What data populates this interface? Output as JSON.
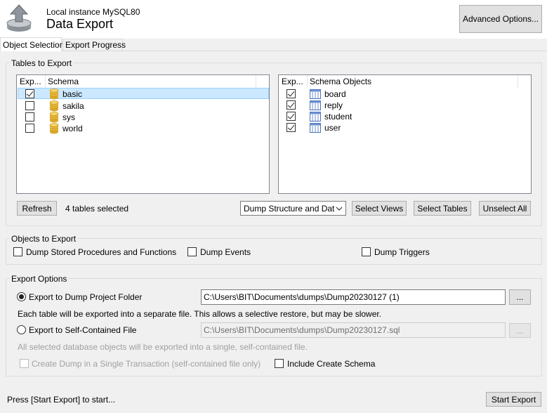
{
  "header": {
    "subtitle": "Local instance MySQL80",
    "title": "Data Export",
    "advanced_options_label": "Advanced Options..."
  },
  "tabs": [
    {
      "label": "Object Selection",
      "active": true
    },
    {
      "label": "Export Progress",
      "active": false
    }
  ],
  "tables_to_export": {
    "title": "Tables to Export",
    "schema_list": {
      "col_export": "Exp...",
      "col_schema": "Schema",
      "rows": [
        {
          "name": "basic",
          "checked": true,
          "selected": true
        },
        {
          "name": "sakila",
          "checked": false,
          "selected": false
        },
        {
          "name": "sys",
          "checked": false,
          "selected": false
        },
        {
          "name": "world",
          "checked": false,
          "selected": false
        }
      ]
    },
    "objects_list": {
      "col_export": "Exp...",
      "col_objects": "Schema Objects",
      "rows": [
        {
          "name": "board",
          "checked": true
        },
        {
          "name": "reply",
          "checked": true
        },
        {
          "name": "student",
          "checked": true
        },
        {
          "name": "user",
          "checked": true
        }
      ]
    },
    "refresh_label": "Refresh",
    "selected_count_text": "4 tables selected",
    "dump_mode_value": "Dump Structure and Dat",
    "select_views_label": "Select Views",
    "select_tables_label": "Select Tables",
    "unselect_all_label": "Unselect All"
  },
  "objects_to_export": {
    "title": "Objects to Export",
    "dump_routines_label": "Dump Stored Procedures and Functions",
    "dump_events_label": "Dump Events",
    "dump_triggers_label": "Dump Triggers"
  },
  "export_options": {
    "title": "Export Options",
    "project_folder_label": "Export to Dump Project Folder",
    "project_folder_path": "C:\\Users\\BIT\\Documents\\dumps\\Dump20230127 (1)",
    "project_folder_note": "Each table will be exported into a separate file. This allows a selective restore, but may be slower.",
    "self_contained_label": "Export to Self-Contained File",
    "self_contained_path": "C:\\Users\\BIT\\Documents\\dumps\\Dump20230127.sql",
    "self_contained_note": "All selected database objects will be exported into a single, self-contained file.",
    "single_transaction_label": "Create Dump in a Single Transaction (self-contained file only)",
    "include_schema_label": "Include Create Schema",
    "browse_label": "..."
  },
  "footer": {
    "status_text": "Press [Start Export] to start...",
    "start_export_label": "Start Export"
  }
}
